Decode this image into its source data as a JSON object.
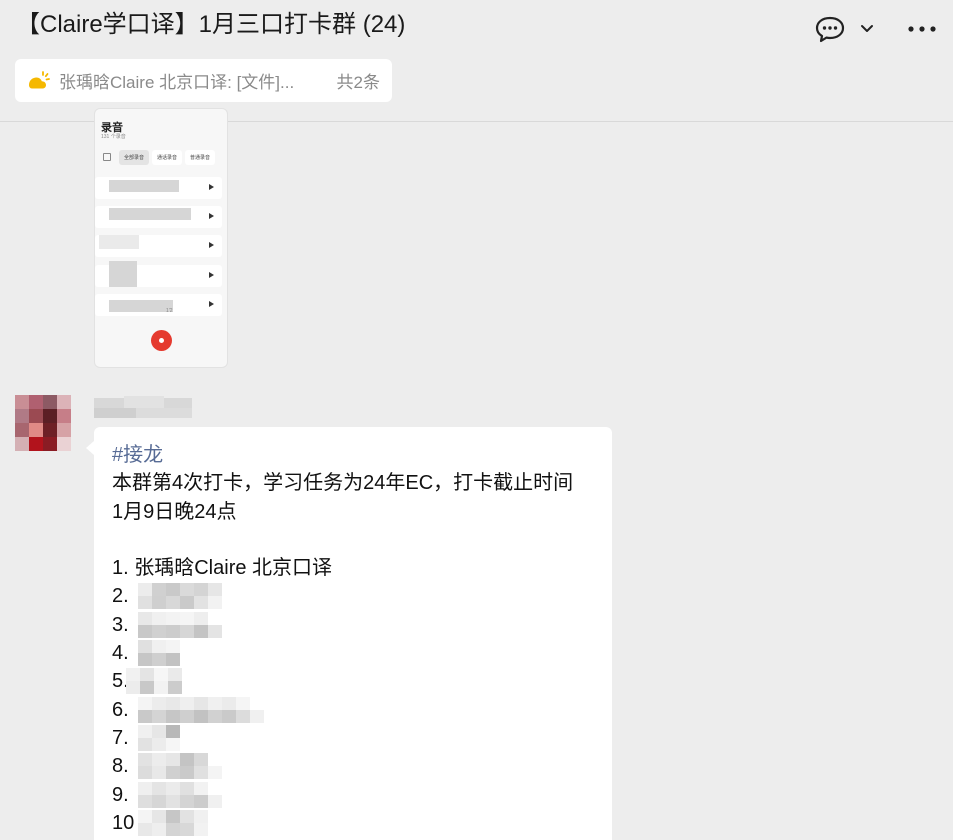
{
  "window": {
    "title": "【Claire学口译】1月三口打卡群 (24)",
    "icons": [
      "chat-bubble-icon",
      "chevron-down-icon",
      "more-icon"
    ]
  },
  "pinned": {
    "icon": "sun-icon",
    "text": "张瑀晗Claire 北京口译: [文件]...",
    "count": "共2条"
  },
  "screenshot_card": {
    "title": "录音",
    "subtitle": "131 个录音",
    "tabs": [
      "全部录音",
      "通话录音",
      "普通录音"
    ],
    "time": "1'2"
  },
  "message": {
    "hashtag": "#接龙",
    "body_line1": "本群第4次打卡，学习任务为24年EC，打卡截止时间",
    "body_line2": "1月9日晚24点",
    "entries": [
      "1. 张瑀晗Claire 北京口译",
      "2.",
      "3.",
      "4.",
      "5.",
      "6.",
      "7.",
      "8.",
      "9.",
      "10"
    ]
  },
  "colors": {
    "background": "#ededed",
    "bubble": "#ffffff",
    "hashtag": "#576b95",
    "record": "#e53a2f",
    "sun": "#f5b800"
  }
}
